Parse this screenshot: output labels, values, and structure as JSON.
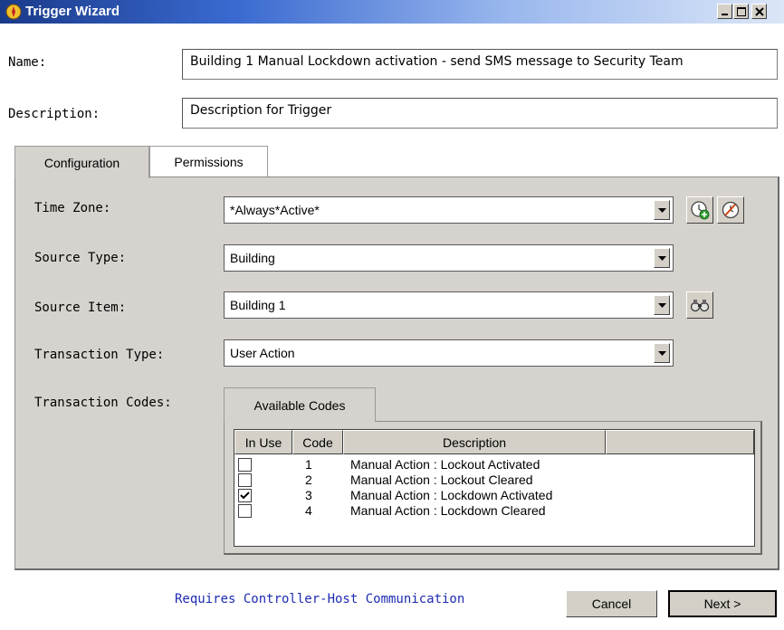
{
  "window": {
    "title": "Trigger Wizard",
    "icon": "trigger-wizard-icon",
    "controls": [
      "minimize",
      "maximize",
      "close"
    ]
  },
  "name_field": {
    "label": "Name:",
    "value": "Building 1 Manual Lockdown activation - send SMS message to Security Team"
  },
  "description_field": {
    "label": "Description:",
    "value": "Description for Trigger"
  },
  "tabs": [
    {
      "label": "Configuration",
      "active": true
    },
    {
      "label": "Permissions",
      "active": false
    }
  ],
  "config": {
    "time_zone": {
      "label": "Time Zone:",
      "value": "*Always*Active*"
    },
    "source_type": {
      "label": "Source Type:",
      "value": "Building"
    },
    "source_item": {
      "label": "Source Item:",
      "value": "Building 1"
    },
    "transaction_type": {
      "label": "Transaction Type:",
      "value": "User Action"
    },
    "transaction_codes": {
      "label": "Transaction Codes:"
    }
  },
  "codes": {
    "tab_label": "Available Codes",
    "columns": [
      "In Use",
      "Code",
      "Description",
      ""
    ],
    "rows": [
      {
        "in_use": false,
        "code": "1",
        "description": "Manual Action : Lockout Activated"
      },
      {
        "in_use": false,
        "code": "2",
        "description": "Manual Action : Lockout Cleared"
      },
      {
        "in_use": true,
        "code": "3",
        "description": "Manual Action : Lockdown Activated"
      },
      {
        "in_use": false,
        "code": "4",
        "description": "Manual Action : Lockdown Cleared"
      }
    ]
  },
  "footer": {
    "note": "Requires Controller-Host Communication",
    "cancel_label": "Cancel",
    "next_label": "Next >"
  },
  "colors": {
    "titlebar_start": "#1a3a8a",
    "panel_bg": "#d6d3ce",
    "footer_note": "#1e2bb0"
  }
}
